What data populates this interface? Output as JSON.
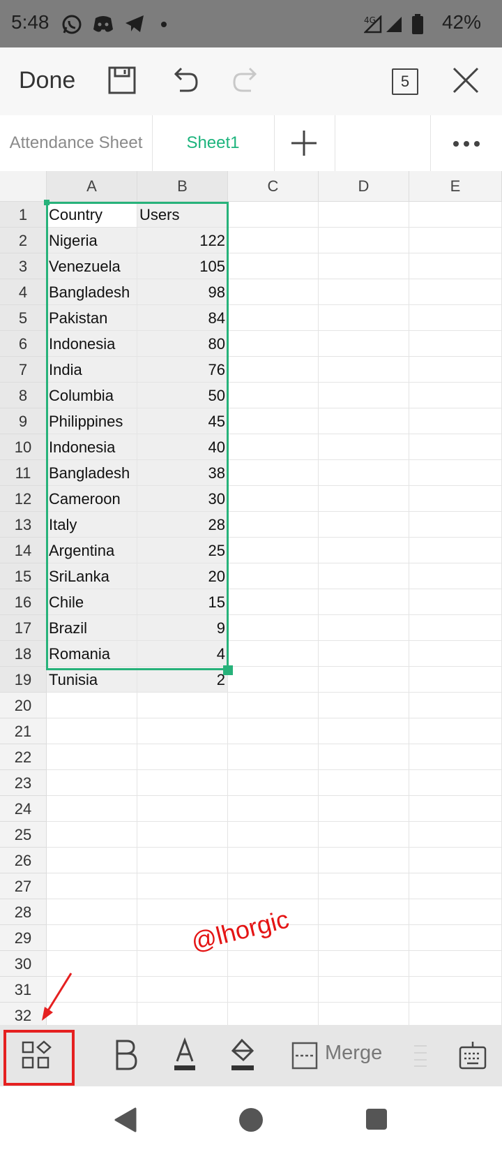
{
  "status_bar": {
    "time": "5:48",
    "network": "4G",
    "battery": "42%",
    "icons": [
      "whatsapp-icon",
      "discord-icon",
      "telegram-icon",
      "dot-icon",
      "signal-icon",
      "battery-icon"
    ]
  },
  "toolbar": {
    "done_label": "Done",
    "page_count": "5",
    "icons": [
      "save-icon",
      "undo-icon",
      "redo-icon",
      "close-icon"
    ]
  },
  "tabs": {
    "items": [
      {
        "label": "Attendance Sheet",
        "active": false
      },
      {
        "label": "Sheet1",
        "active": true
      }
    ],
    "add_icon": "plus-icon",
    "more_icon": "more-icon"
  },
  "sheet": {
    "columns": [
      "A",
      "B",
      "C",
      "D",
      "E"
    ],
    "row_numbers": [
      "1",
      "2",
      "3",
      "4",
      "5",
      "6",
      "7",
      "8",
      "9",
      "10",
      "11",
      "12",
      "13",
      "14",
      "15",
      "16",
      "17",
      "18",
      "19",
      "20",
      "21",
      "22",
      "23",
      "24",
      "25",
      "26",
      "27",
      "28",
      "29",
      "30",
      "31",
      "32"
    ],
    "header": {
      "a": "Country",
      "b": "Users"
    },
    "rows": [
      {
        "a": "Nigeria",
        "b": "122"
      },
      {
        "a": "Venezuela",
        "b": "105"
      },
      {
        "a": "Bangladesh",
        "b": "98"
      },
      {
        "a": "Pakistan",
        "b": "84"
      },
      {
        "a": "Indonesia",
        "b": "80"
      },
      {
        "a": "India",
        "b": "76"
      },
      {
        "a": "Columbia",
        "b": "50"
      },
      {
        "a": "Philippines",
        "b": "45"
      },
      {
        "a": "Indonesia",
        "b": "40"
      },
      {
        "a": "Bangladesh",
        "b": "38"
      },
      {
        "a": "Cameroon",
        "b": "30"
      },
      {
        "a": "Italy",
        "b": "28"
      },
      {
        "a": "Argentina",
        "b": "25"
      },
      {
        "a": "SriLanka",
        "b": "20"
      },
      {
        "a": "Chile",
        "b": "15"
      },
      {
        "a": "Brazil",
        "b": "9"
      },
      {
        "a": "Romania",
        "b": "4"
      },
      {
        "a": "Tunisia",
        "b": "2"
      }
    ],
    "selection": "A1:B19",
    "watermark": "@lhorgic"
  },
  "format_bar": {
    "merge_label": "Merge",
    "icons": [
      "apps-grid-icon",
      "bold-icon",
      "font-color-icon",
      "fill-color-icon",
      "merge-icon",
      "align-icon",
      "keyboard-icon"
    ]
  },
  "colors": {
    "accent": "#27b27a",
    "annotation": "#e52020"
  }
}
